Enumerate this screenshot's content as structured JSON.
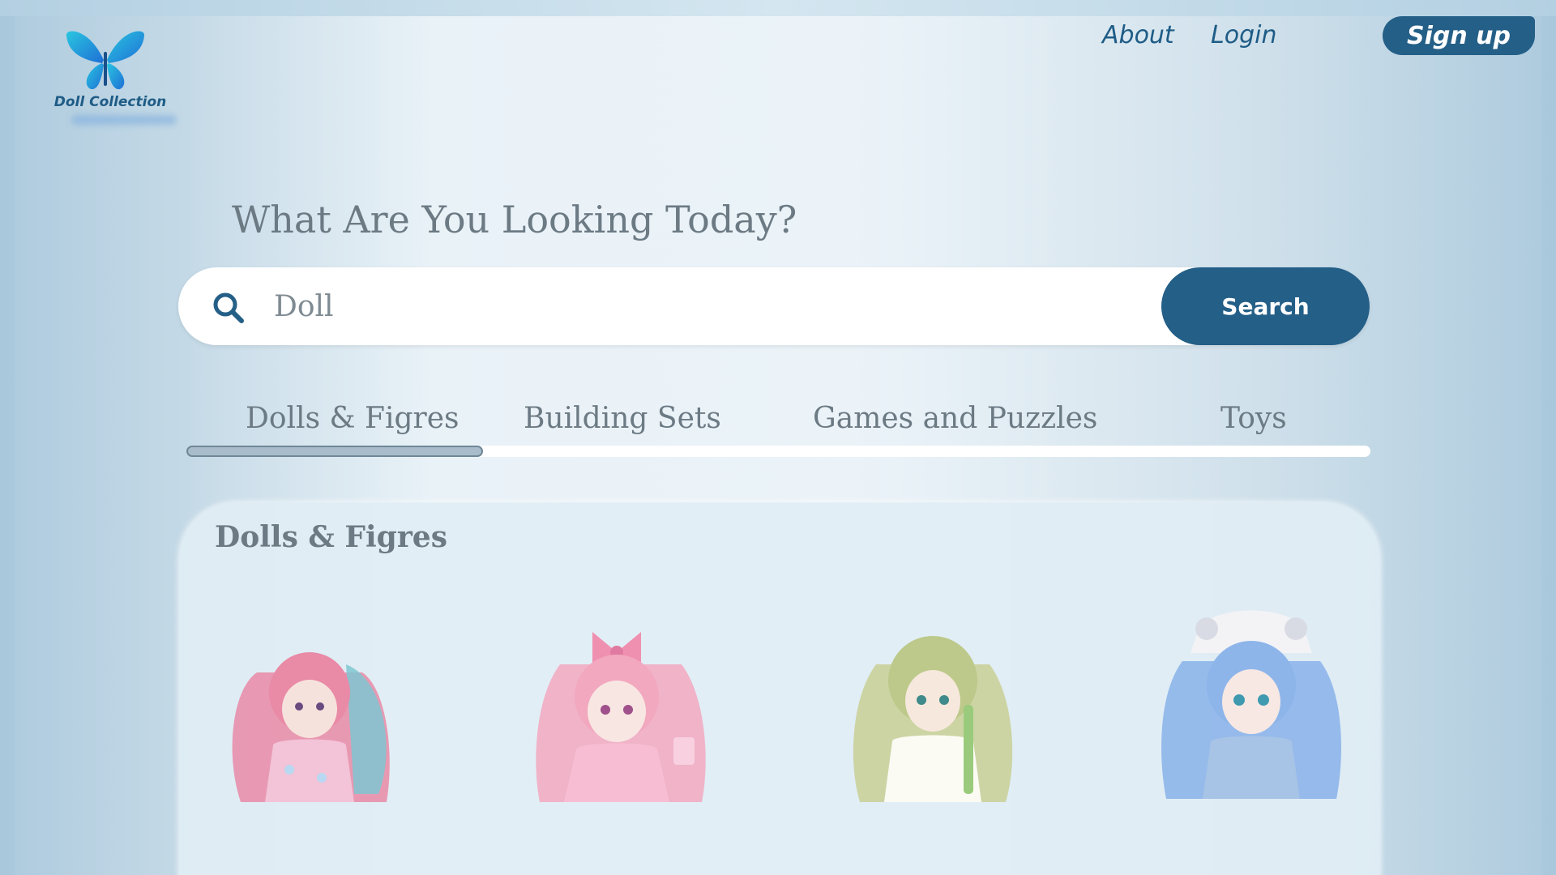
{
  "brand": {
    "name": "Doll Collection",
    "accent": "#245f87"
  },
  "nav": {
    "about": "About",
    "login": "Login",
    "signup": "Sign up"
  },
  "hero": {
    "heading": "What Are You Looking Today?"
  },
  "search": {
    "value": "Doll",
    "button": "Search",
    "icon": "search-icon"
  },
  "tabs": [
    {
      "label": "Dolls & Figres",
      "active": true
    },
    {
      "label": "Building Sets",
      "active": false
    },
    {
      "label": "Games and Puzzles",
      "active": false
    },
    {
      "label": "Toys",
      "active": false
    }
  ],
  "panel": {
    "title": "Dolls & Figres",
    "products": [
      {
        "name": "pink-twin-tail-doll",
        "hair": "#e98aa6"
      },
      {
        "name": "pink-bow-doll",
        "hair": "#f2a8bf"
      },
      {
        "name": "green-hair-doll",
        "hair": "#bcc98a"
      },
      {
        "name": "blue-hair-doll",
        "hair": "#8db5ea"
      }
    ]
  }
}
